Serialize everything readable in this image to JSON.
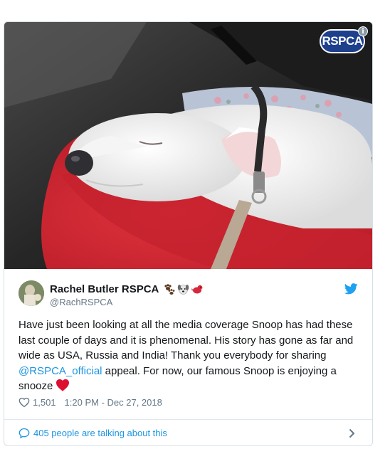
{
  "media": {
    "badge_text": "RSPCA",
    "info_glyph": "i"
  },
  "author": {
    "display_name": "Rachel Butler RSPCA",
    "handle": "@RachRSPCA",
    "emojis": [
      "paw-prints-emoji",
      "dog-face-emoji",
      "bird-emoji"
    ]
  },
  "tweet": {
    "text_before": "Have just been looking at all the media coverage Snoop has had these last couple of days and it is phenomenal. His story has gone as far and wide as USA, Russia and India! Thank you everybody for sharing ",
    "mention": "@RSPCA_official",
    "text_after": " appeal. For now, our famous Snoop is enjoying a snooze",
    "likes": "1,501",
    "timestamp": "1:20 PM - Dec 27, 2018"
  },
  "footer": {
    "conversation_label": "405 people are talking about this"
  },
  "colors": {
    "link": "#1b95e0",
    "muted": "#657786",
    "heart": "#e0245e",
    "rspca_blue": "#1d3f8c"
  }
}
